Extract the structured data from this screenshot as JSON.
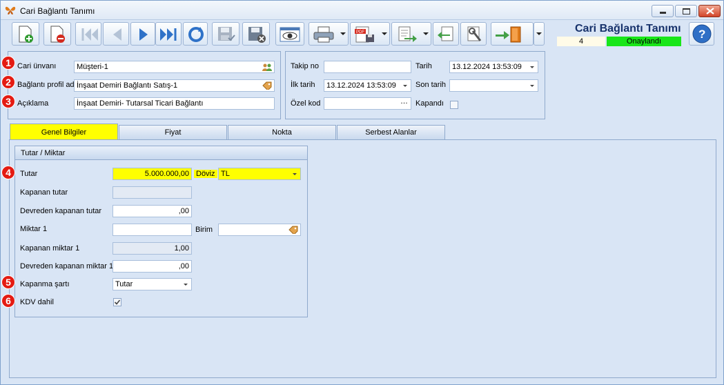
{
  "window": {
    "title": "Cari Bağlantı Tanımı"
  },
  "toolbar": {
    "buttons": [
      {
        "name": "new-record-icon"
      },
      {
        "name": "delete-record-icon"
      },
      {
        "name": "first-record-icon"
      },
      {
        "name": "previous-record-icon"
      },
      {
        "name": "next-record-icon"
      },
      {
        "name": "last-record-icon"
      },
      {
        "name": "refresh-icon"
      },
      {
        "name": "save-icon"
      },
      {
        "name": "cancel-save-icon"
      },
      {
        "name": "preview-icon"
      },
      {
        "name": "print-icon"
      },
      {
        "name": "pdf-export-icon"
      },
      {
        "name": "export-icon"
      },
      {
        "name": "import-icon"
      },
      {
        "name": "tools-icon"
      },
      {
        "name": "exit-icon"
      }
    ]
  },
  "header": {
    "title": "Cari Bağlantı Tanımı",
    "count": "4",
    "status": "Onaylandı",
    "status_color": "#19e619"
  },
  "form": {
    "cari_unvani": {
      "label": "Cari ünvanı",
      "value": "Müşteri-1"
    },
    "profil": {
      "label": "Bağlantı profil adı",
      "value": "İnşaat Demiri Bağlantı Satış-1"
    },
    "aciklama": {
      "label": "Açıklama",
      "value": "İnşaat Demiri- Tutarsal Ticari Bağlantı"
    },
    "takip_no": {
      "label": "Takip no",
      "value": ""
    },
    "tarih": {
      "label": "Tarih",
      "value": "13.12.2024 13:53:09"
    },
    "ilk_tarih": {
      "label": "İlk tarih",
      "value": "13.12.2024 13:53:09"
    },
    "son_tarih": {
      "label": "Son tarih",
      "value": " .  .       :  :"
    },
    "ozel_kod": {
      "label": "Özel kod",
      "value": ""
    },
    "kapandi": {
      "label": "Kapandı",
      "checked": false
    }
  },
  "tabs": [
    {
      "label": "Genel Bilgiler",
      "active": true
    },
    {
      "label": "Fiyat"
    },
    {
      "label": "Nokta"
    },
    {
      "label": "Serbest Alanlar"
    }
  ],
  "group": {
    "title": "Tutar / Miktar",
    "tutar": {
      "label": "Tutar",
      "value": "5.000.000,00"
    },
    "doviz": {
      "label": "Döviz",
      "value": "TL"
    },
    "kapanan_tutar": {
      "label": "Kapanan tutar",
      "value": ""
    },
    "devreden_kapanan_tutar": {
      "label": "Devreden kapanan tutar",
      "value": ",00"
    },
    "miktar1": {
      "label": "Miktar 1",
      "value": ""
    },
    "birim": {
      "label": "Birim",
      "value": ""
    },
    "kapanan_miktar1": {
      "label": "Kapanan miktar 1",
      "value": "1,00"
    },
    "devreden_kapanan_miktar1": {
      "label": "Devreden kapanan miktar 1",
      "value": ",00"
    },
    "kapanma_sarti": {
      "label": "Kapanma şartı",
      "value": "Tutar"
    },
    "kdv_dahil": {
      "label": "KDV dahil",
      "checked": true
    }
  },
  "badges": [
    "1",
    "2",
    "3",
    "4",
    "5",
    "6"
  ]
}
